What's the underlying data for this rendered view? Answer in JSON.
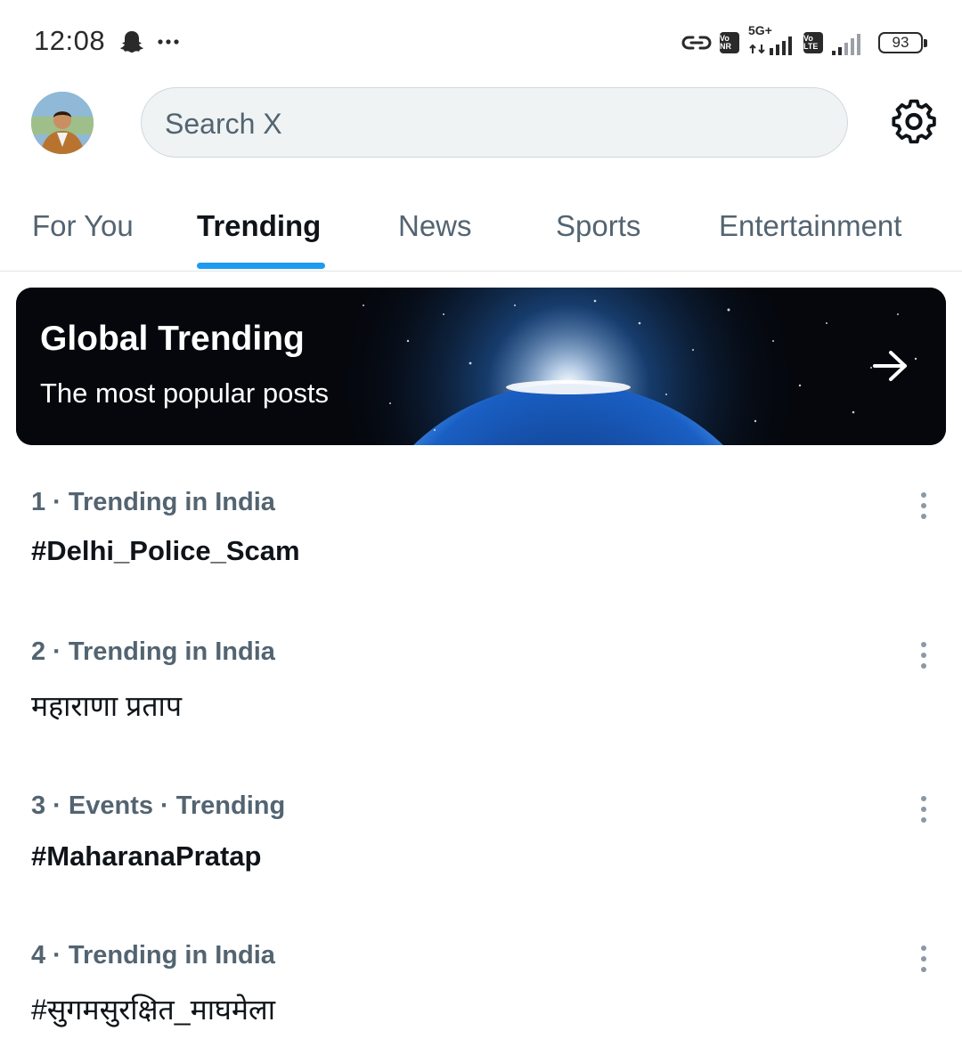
{
  "status_bar": {
    "time": "12:08",
    "icons": [
      "snapchat-icon",
      "more-notifications-icon",
      "link-icon",
      "vonr-icon",
      "5g-signal-icon",
      "volte-icon",
      "signal-icon"
    ],
    "network_label": "5G+",
    "chip_vonr": "Vo NR",
    "chip_volte": "Vo LTE",
    "battery": "93"
  },
  "header": {
    "search_placeholder": "Search X",
    "settings_icon": "gear-icon"
  },
  "tabs": [
    {
      "label": "For You",
      "active": false
    },
    {
      "label": "Trending",
      "active": true
    },
    {
      "label": "News",
      "active": false
    },
    {
      "label": "Sports",
      "active": false
    },
    {
      "label": "Entertainment",
      "active": false
    }
  ],
  "banner": {
    "title": "Global Trending",
    "subtitle": "The most popular posts"
  },
  "trends": [
    {
      "meta": "1 · Trending in India",
      "name": "#Delhi_Police_Scam"
    },
    {
      "meta": "2 · Trending in India",
      "name": "महाराणा प्रताप"
    },
    {
      "meta": "3 · Events · Trending",
      "name": "#MaharanaPratap"
    },
    {
      "meta": "4 · Trending in India",
      "name": "#सुगमसुरक्षित_माघमेला"
    }
  ],
  "colors": {
    "accent": "#1d9bf0",
    "secondary_text": "#536471",
    "primary_text": "#0f1419",
    "search_bg": "#eff3f4"
  }
}
